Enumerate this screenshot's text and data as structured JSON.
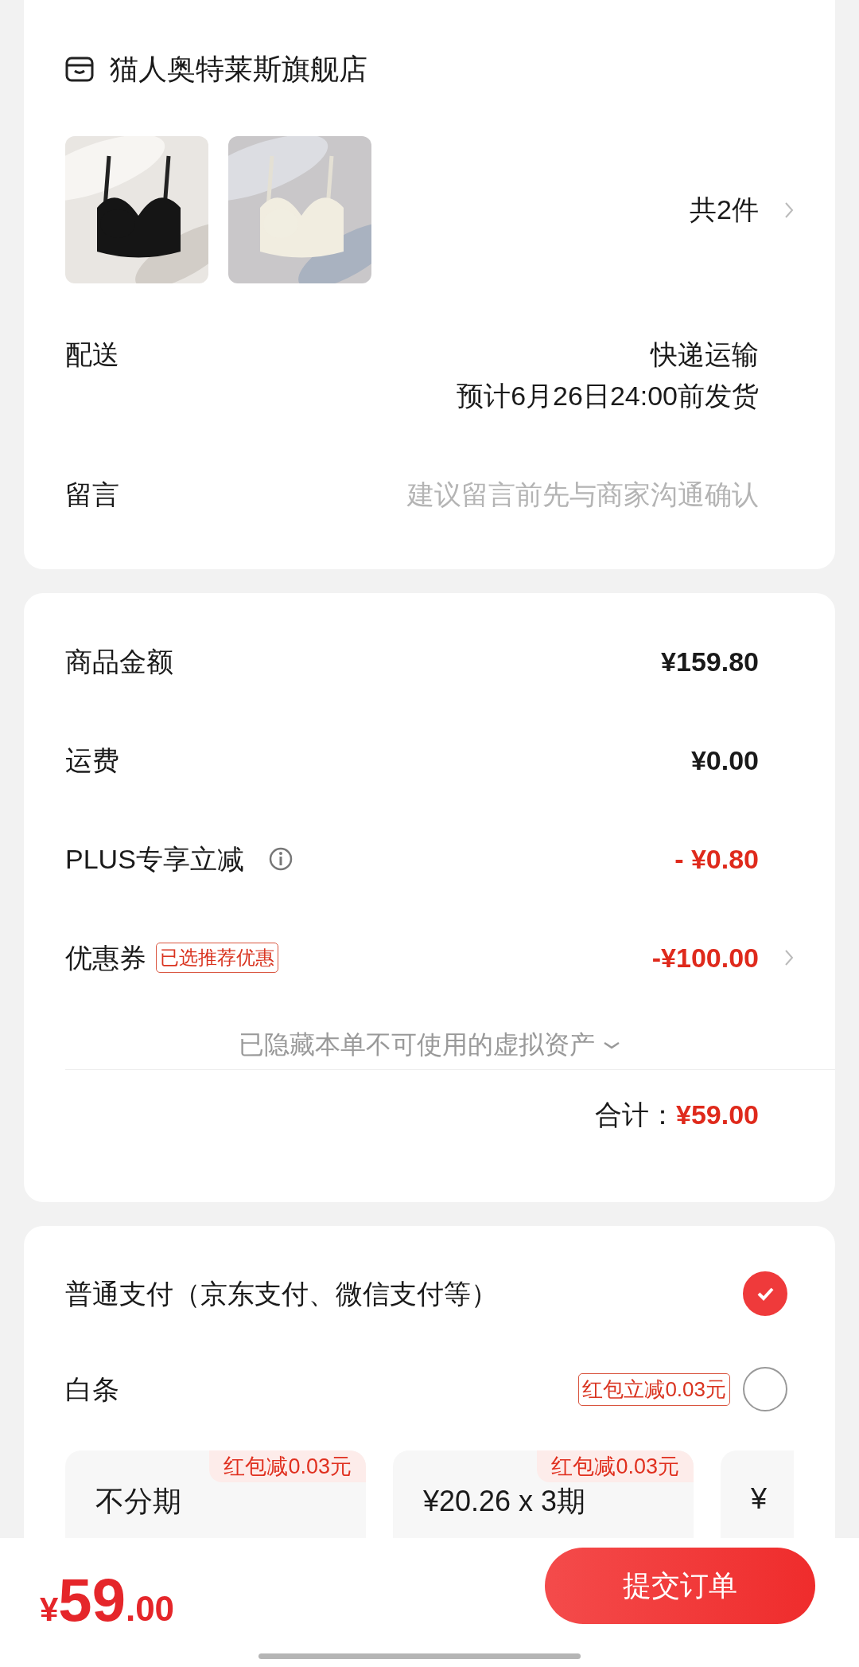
{
  "store": {
    "name": "猫人奥特莱斯旗舰店"
  },
  "products": {
    "count": "共2件"
  },
  "delivery": {
    "label": "配送",
    "method": "快递运输",
    "eta": "预计6月26日24:00前发货"
  },
  "message": {
    "label": "留言",
    "placeholder": "建议留言前先与商家沟通确认"
  },
  "summary": {
    "rows": [
      {
        "kind": "plain",
        "label": "商品金额",
        "value": "¥159.80"
      },
      {
        "kind": "plain",
        "label": "运费",
        "value": "¥0.00"
      },
      {
        "kind": "info",
        "label": "PLUS专享立减",
        "value": "- ¥0.80"
      },
      {
        "kind": "coupon",
        "label": "优惠券",
        "tag": "已选推荐优惠",
        "value": "-¥100.00"
      }
    ],
    "hidden_note": "已隐藏本单不可使用的虚拟资产",
    "total_label": "合计：",
    "total": "¥59.00"
  },
  "payment": {
    "options": [
      {
        "label": "普通支付（京东支付、微信支付等）",
        "selected": true
      },
      {
        "label": "白条",
        "badge": "红包立减0.03元",
        "selected": false
      }
    ],
    "plans": [
      {
        "tag": "红包减0.03元",
        "title": "不分期"
      },
      {
        "tag": "红包减0.03元",
        "title": "¥20.26 x 3期"
      },
      {
        "title": "¥"
      }
    ]
  },
  "footer": {
    "currency": "¥",
    "integer": "59",
    "decimal": ".00",
    "submit": "提交订单"
  }
}
